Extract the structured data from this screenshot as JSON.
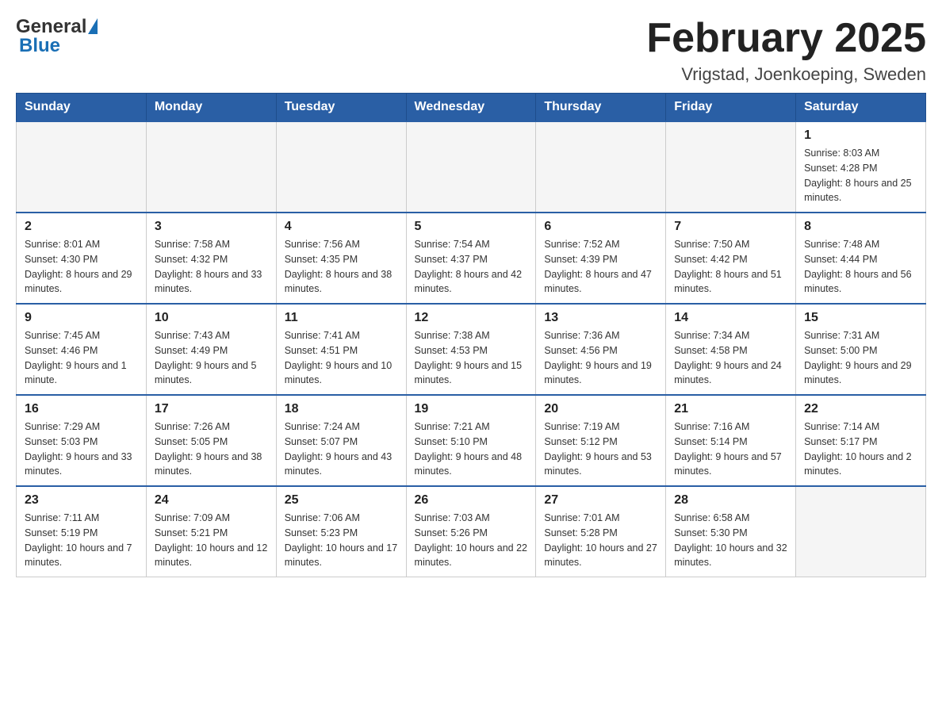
{
  "header": {
    "logo_general": "General",
    "logo_blue": "Blue",
    "month_title": "February 2025",
    "location": "Vrigstad, Joenkoeping, Sweden"
  },
  "weekdays": [
    "Sunday",
    "Monday",
    "Tuesday",
    "Wednesday",
    "Thursday",
    "Friday",
    "Saturday"
  ],
  "weeks": [
    [
      {
        "day": "",
        "sunrise": "",
        "sunset": "",
        "daylight": ""
      },
      {
        "day": "",
        "sunrise": "",
        "sunset": "",
        "daylight": ""
      },
      {
        "day": "",
        "sunrise": "",
        "sunset": "",
        "daylight": ""
      },
      {
        "day": "",
        "sunrise": "",
        "sunset": "",
        "daylight": ""
      },
      {
        "day": "",
        "sunrise": "",
        "sunset": "",
        "daylight": ""
      },
      {
        "day": "",
        "sunrise": "",
        "sunset": "",
        "daylight": ""
      },
      {
        "day": "1",
        "sunrise": "Sunrise: 8:03 AM",
        "sunset": "Sunset: 4:28 PM",
        "daylight": "Daylight: 8 hours and 25 minutes."
      }
    ],
    [
      {
        "day": "2",
        "sunrise": "Sunrise: 8:01 AM",
        "sunset": "Sunset: 4:30 PM",
        "daylight": "Daylight: 8 hours and 29 minutes."
      },
      {
        "day": "3",
        "sunrise": "Sunrise: 7:58 AM",
        "sunset": "Sunset: 4:32 PM",
        "daylight": "Daylight: 8 hours and 33 minutes."
      },
      {
        "day": "4",
        "sunrise": "Sunrise: 7:56 AM",
        "sunset": "Sunset: 4:35 PM",
        "daylight": "Daylight: 8 hours and 38 minutes."
      },
      {
        "day": "5",
        "sunrise": "Sunrise: 7:54 AM",
        "sunset": "Sunset: 4:37 PM",
        "daylight": "Daylight: 8 hours and 42 minutes."
      },
      {
        "day": "6",
        "sunrise": "Sunrise: 7:52 AM",
        "sunset": "Sunset: 4:39 PM",
        "daylight": "Daylight: 8 hours and 47 minutes."
      },
      {
        "day": "7",
        "sunrise": "Sunrise: 7:50 AM",
        "sunset": "Sunset: 4:42 PM",
        "daylight": "Daylight: 8 hours and 51 minutes."
      },
      {
        "day": "8",
        "sunrise": "Sunrise: 7:48 AM",
        "sunset": "Sunset: 4:44 PM",
        "daylight": "Daylight: 8 hours and 56 minutes."
      }
    ],
    [
      {
        "day": "9",
        "sunrise": "Sunrise: 7:45 AM",
        "sunset": "Sunset: 4:46 PM",
        "daylight": "Daylight: 9 hours and 1 minute."
      },
      {
        "day": "10",
        "sunrise": "Sunrise: 7:43 AM",
        "sunset": "Sunset: 4:49 PM",
        "daylight": "Daylight: 9 hours and 5 minutes."
      },
      {
        "day": "11",
        "sunrise": "Sunrise: 7:41 AM",
        "sunset": "Sunset: 4:51 PM",
        "daylight": "Daylight: 9 hours and 10 minutes."
      },
      {
        "day": "12",
        "sunrise": "Sunrise: 7:38 AM",
        "sunset": "Sunset: 4:53 PM",
        "daylight": "Daylight: 9 hours and 15 minutes."
      },
      {
        "day": "13",
        "sunrise": "Sunrise: 7:36 AM",
        "sunset": "Sunset: 4:56 PM",
        "daylight": "Daylight: 9 hours and 19 minutes."
      },
      {
        "day": "14",
        "sunrise": "Sunrise: 7:34 AM",
        "sunset": "Sunset: 4:58 PM",
        "daylight": "Daylight: 9 hours and 24 minutes."
      },
      {
        "day": "15",
        "sunrise": "Sunrise: 7:31 AM",
        "sunset": "Sunset: 5:00 PM",
        "daylight": "Daylight: 9 hours and 29 minutes."
      }
    ],
    [
      {
        "day": "16",
        "sunrise": "Sunrise: 7:29 AM",
        "sunset": "Sunset: 5:03 PM",
        "daylight": "Daylight: 9 hours and 33 minutes."
      },
      {
        "day": "17",
        "sunrise": "Sunrise: 7:26 AM",
        "sunset": "Sunset: 5:05 PM",
        "daylight": "Daylight: 9 hours and 38 minutes."
      },
      {
        "day": "18",
        "sunrise": "Sunrise: 7:24 AM",
        "sunset": "Sunset: 5:07 PM",
        "daylight": "Daylight: 9 hours and 43 minutes."
      },
      {
        "day": "19",
        "sunrise": "Sunrise: 7:21 AM",
        "sunset": "Sunset: 5:10 PM",
        "daylight": "Daylight: 9 hours and 48 minutes."
      },
      {
        "day": "20",
        "sunrise": "Sunrise: 7:19 AM",
        "sunset": "Sunset: 5:12 PM",
        "daylight": "Daylight: 9 hours and 53 minutes."
      },
      {
        "day": "21",
        "sunrise": "Sunrise: 7:16 AM",
        "sunset": "Sunset: 5:14 PM",
        "daylight": "Daylight: 9 hours and 57 minutes."
      },
      {
        "day": "22",
        "sunrise": "Sunrise: 7:14 AM",
        "sunset": "Sunset: 5:17 PM",
        "daylight": "Daylight: 10 hours and 2 minutes."
      }
    ],
    [
      {
        "day": "23",
        "sunrise": "Sunrise: 7:11 AM",
        "sunset": "Sunset: 5:19 PM",
        "daylight": "Daylight: 10 hours and 7 minutes."
      },
      {
        "day": "24",
        "sunrise": "Sunrise: 7:09 AM",
        "sunset": "Sunset: 5:21 PM",
        "daylight": "Daylight: 10 hours and 12 minutes."
      },
      {
        "day": "25",
        "sunrise": "Sunrise: 7:06 AM",
        "sunset": "Sunset: 5:23 PM",
        "daylight": "Daylight: 10 hours and 17 minutes."
      },
      {
        "day": "26",
        "sunrise": "Sunrise: 7:03 AM",
        "sunset": "Sunset: 5:26 PM",
        "daylight": "Daylight: 10 hours and 22 minutes."
      },
      {
        "day": "27",
        "sunrise": "Sunrise: 7:01 AM",
        "sunset": "Sunset: 5:28 PM",
        "daylight": "Daylight: 10 hours and 27 minutes."
      },
      {
        "day": "28",
        "sunrise": "Sunrise: 6:58 AM",
        "sunset": "Sunset: 5:30 PM",
        "daylight": "Daylight: 10 hours and 32 minutes."
      },
      {
        "day": "",
        "sunrise": "",
        "sunset": "",
        "daylight": ""
      }
    ]
  ]
}
